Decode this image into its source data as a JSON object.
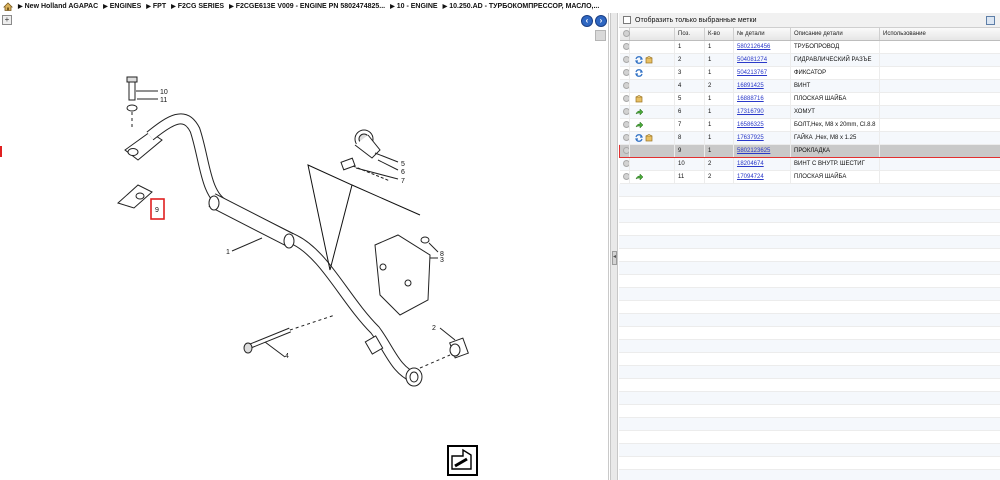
{
  "breadcrumb": [
    "New Holland AGAPAC",
    "ENGINES",
    "FPT",
    "F2CG SERIES",
    "F2CGE613E V009 - ENGINE PN 5802474825...",
    "10 - ENGINE",
    "10.250.AD - ТУРБОКОМПРЕССОР, МАСЛО,..."
  ],
  "filter": {
    "label": "Отобразить только выбранные метки"
  },
  "table": {
    "headers": [
      "",
      "",
      "Поз.",
      "К-во",
      "№ детали",
      "Описание детали",
      "Использование"
    ],
    "rows": [
      {
        "pos": "1",
        "qty": "1",
        "part": "5802126456",
        "desc": "ТРУБОПРОВОД",
        "icons": []
      },
      {
        "pos": "2",
        "qty": "1",
        "part": "504081274",
        "desc": "ГИДРАВЛИЧЕСКИЙ РАЗЪЕ",
        "icons": [
          "replace-icon",
          "box-icon"
        ]
      },
      {
        "pos": "3",
        "qty": "1",
        "part": "504213767",
        "desc": "ФИКСАТОР",
        "icons": [
          "replace-icon"
        ]
      },
      {
        "pos": "4",
        "qty": "2",
        "part": "16891425",
        "desc": "ВИНТ",
        "icons": []
      },
      {
        "pos": "5",
        "qty": "1",
        "part": "16888716",
        "desc": "ПЛОСКАЯ ШАЙБА",
        "icons": [
          "box-icon"
        ]
      },
      {
        "pos": "6",
        "qty": "1",
        "part": "17316790",
        "desc": "ХОМУТ",
        "icons": [
          "arrow-icon"
        ]
      },
      {
        "pos": "7",
        "qty": "1",
        "part": "16586325",
        "desc": "БОЛТ,Hex, M8 x 20mm, Cl.8.8",
        "icons": [
          "arrow-icon"
        ]
      },
      {
        "pos": "8",
        "qty": "1",
        "part": "17637925",
        "desc": "ГАЙКА ,Hex, M8 x 1.25",
        "icons": [
          "replace-icon",
          "box-icon"
        ]
      },
      {
        "pos": "9",
        "qty": "1",
        "part": "5802123625",
        "desc": "ПРОКЛАДКА",
        "icons": [],
        "selected": true
      },
      {
        "pos": "10",
        "qty": "2",
        "part": "18204674",
        "desc": "ВИНТ С ВНУТР. ШЕСТИГ",
        "icons": []
      },
      {
        "pos": "11",
        "qty": "2",
        "part": "17094724",
        "desc": "ПЛОСКАЯ ШАЙБА",
        "icons": [
          "arrow-icon"
        ]
      }
    ]
  },
  "diagram": {
    "callouts": [
      "10",
      "11",
      "5",
      "6",
      "7",
      "9",
      "1",
      "8",
      "3",
      "2",
      "4"
    ]
  },
  "colors": {
    "link": "#2a39c9",
    "selection_outline": "#e23030",
    "nav_button": "#2f67c2"
  }
}
